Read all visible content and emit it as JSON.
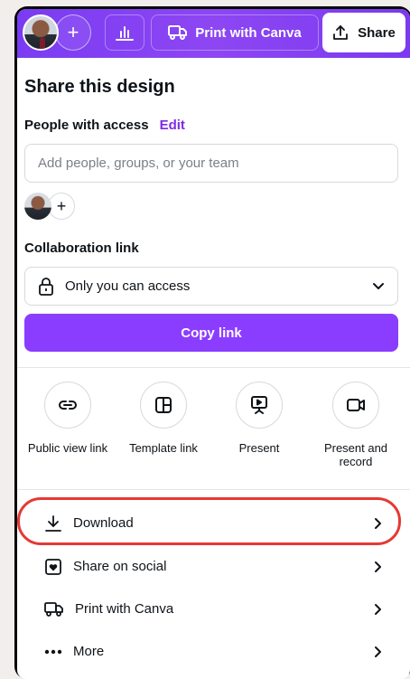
{
  "topbar": {
    "print_label": "Print with Canva",
    "share_label": "Share",
    "icons": [
      "plus-icon",
      "bar-chart-icon",
      "truck-icon",
      "upload-icon"
    ]
  },
  "panel": {
    "title": "Share this design",
    "people_label": "People with access",
    "edit_label": "Edit",
    "people_placeholder": "Add people, groups, or your team",
    "collab_label": "Collaboration link",
    "access_value": "Only you can access",
    "copy_link_label": "Copy link"
  },
  "quick_actions": [
    {
      "label": "Public view link",
      "icon": "link-icon"
    },
    {
      "label": "Template link",
      "icon": "template-icon"
    },
    {
      "label": "Present",
      "icon": "present-icon"
    },
    {
      "label": "Present and record",
      "icon": "camera-icon"
    }
  ],
  "menu": [
    {
      "label": "Download",
      "icon": "download-icon"
    },
    {
      "label": "Share on social",
      "icon": "heart-square-icon"
    },
    {
      "label": "Print with Canva",
      "icon": "truck-icon"
    },
    {
      "label": "More",
      "icon": "more-dots-icon"
    }
  ],
  "colors": {
    "brand_purple": "#8b3dff",
    "edit_link": "#7d2ae8",
    "highlight_red": "#e53935"
  }
}
